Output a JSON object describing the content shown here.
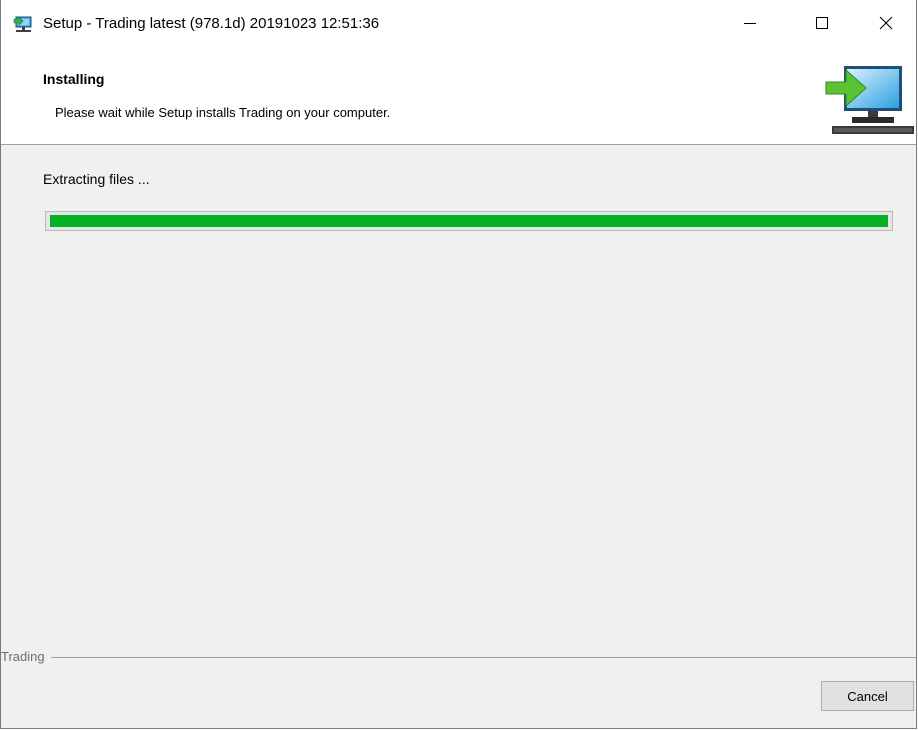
{
  "window": {
    "title": "Setup - Trading latest (978.1d) 20191023 12:51:36"
  },
  "icons": {
    "app": "installer-app-icon",
    "minimize": "minimize-icon",
    "maximize": "maximize-icon",
    "close": "close-icon",
    "wizard": "computer-install-arrow-icon"
  },
  "header": {
    "title": "Installing",
    "subtitle": "Please wait while Setup installs Trading on your computer."
  },
  "main": {
    "status": "Extracting files ...",
    "progress": 1.0
  },
  "footer": {
    "brand": "Trading",
    "cancel_label": "Cancel"
  },
  "colors": {
    "progress_fill": "#06b025",
    "body_background": "#f0f0f0",
    "header_background": "#ffffff"
  }
}
